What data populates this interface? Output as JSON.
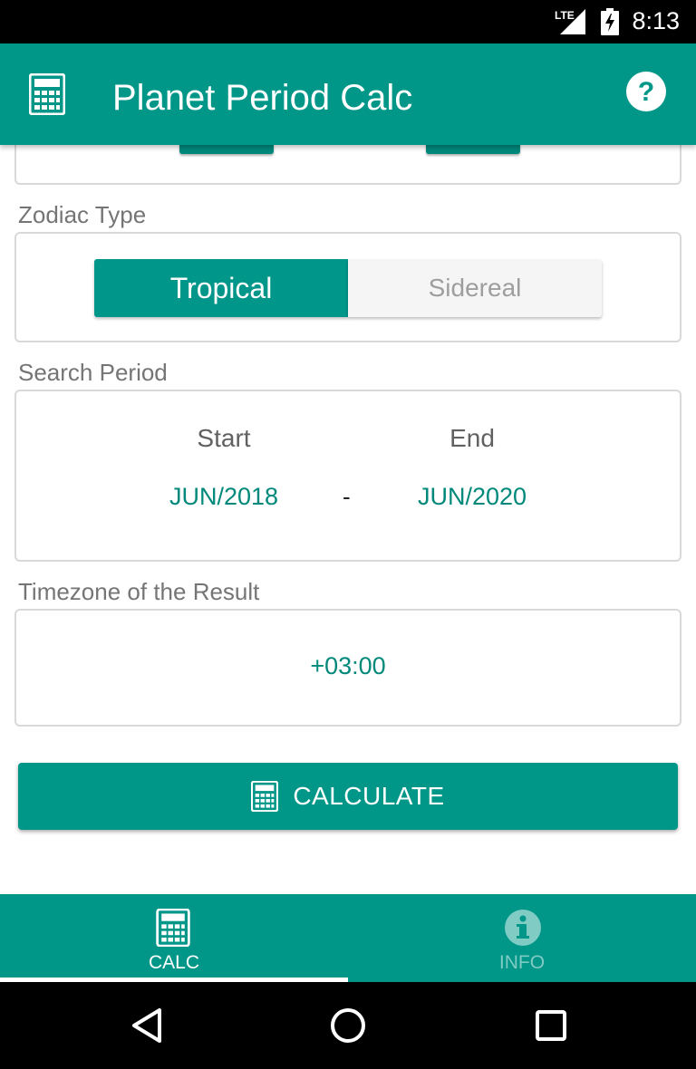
{
  "status_bar": {
    "time": "8:13",
    "network": "LTE"
  },
  "app_bar": {
    "title": "Planet Period Calc",
    "left_icon": "calculator-icon",
    "right_icon": "help-icon"
  },
  "zodiac": {
    "label": "Zodiac Type",
    "options": [
      "Tropical",
      "Sidereal"
    ],
    "selected": "Tropical"
  },
  "search_period": {
    "label": "Search Period",
    "start_label": "Start",
    "end_label": "End",
    "start_value": "JUN/2018",
    "separator": "-",
    "end_value": "JUN/2020"
  },
  "timezone": {
    "label": "Timezone of the Result",
    "value": "+03:00"
  },
  "calculate_button": {
    "label": "CALCULATE",
    "icon": "calculator-icon"
  },
  "bottom_nav": {
    "items": [
      {
        "label": "CALC",
        "icon": "calculator-icon",
        "active": true
      },
      {
        "label": "INFO",
        "icon": "info-icon",
        "active": false
      }
    ]
  },
  "system_nav": {
    "buttons": [
      "back",
      "home",
      "recents"
    ]
  },
  "colors": {
    "accent": "#009688",
    "accent_text": "#00897b",
    "inactive_nav": "#80cbc4"
  }
}
